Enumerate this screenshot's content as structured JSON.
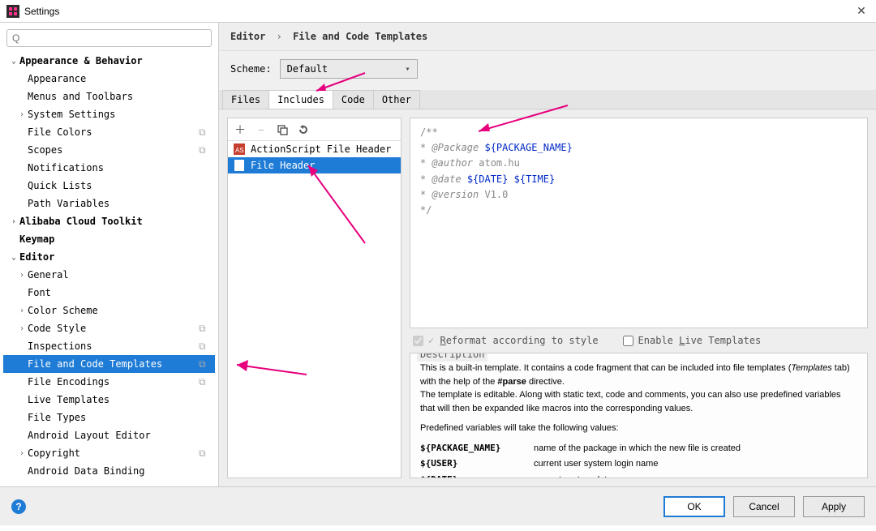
{
  "window": {
    "title": "Settings",
    "close_glyph": "✕"
  },
  "search": {
    "placeholder": "Q"
  },
  "tree": [
    {
      "label": "Appearance & Behavior",
      "chev": "⌄",
      "bold": true,
      "ind": 0
    },
    {
      "label": "Appearance",
      "ind": 1
    },
    {
      "label": "Menus and Toolbars",
      "ind": 1
    },
    {
      "label": "System Settings",
      "chev": "›",
      "ind": 1
    },
    {
      "label": "File Colors",
      "ind": 1,
      "copy": true
    },
    {
      "label": "Scopes",
      "ind": 1,
      "copy": true
    },
    {
      "label": "Notifications",
      "ind": 1
    },
    {
      "label": "Quick Lists",
      "ind": 1
    },
    {
      "label": "Path Variables",
      "ind": 1
    },
    {
      "label": "Alibaba Cloud Toolkit",
      "chev": "›",
      "bold": true,
      "ind": 0
    },
    {
      "label": "Keymap",
      "bold": true,
      "ind": 0
    },
    {
      "label": "Editor",
      "chev": "⌄",
      "bold": true,
      "ind": 0
    },
    {
      "label": "General",
      "chev": "›",
      "ind": 1
    },
    {
      "label": "Font",
      "ind": 1
    },
    {
      "label": "Color Scheme",
      "chev": "›",
      "ind": 1
    },
    {
      "label": "Code Style",
      "chev": "›",
      "ind": 1,
      "copy": true
    },
    {
      "label": "Inspections",
      "ind": 1,
      "copy": true
    },
    {
      "label": "File and Code Templates",
      "ind": 1,
      "copy": true,
      "sel": true
    },
    {
      "label": "File Encodings",
      "ind": 1,
      "copy": true
    },
    {
      "label": "Live Templates",
      "ind": 1
    },
    {
      "label": "File Types",
      "ind": 1
    },
    {
      "label": "Android Layout Editor",
      "ind": 1
    },
    {
      "label": "Copyright",
      "chev": "›",
      "ind": 1,
      "copy": true
    },
    {
      "label": "Android Data Binding",
      "ind": 1
    }
  ],
  "breadcrumb": {
    "a": "Editor",
    "b": "File and Code Templates"
  },
  "scheme": {
    "label": "Scheme:",
    "value": "Default"
  },
  "tabs": [
    "Files",
    "Includes",
    "Code",
    "Other"
  ],
  "active_tab": 1,
  "templates": [
    {
      "label": "ActionScript File Header",
      "icon": "as",
      "sel": false
    },
    {
      "label": "File Header",
      "icon": "file",
      "sel": true
    }
  ],
  "code": {
    "l0": "/**",
    "l1a": " * ",
    "l1b": "@Package",
    "l1c": " ",
    "l1d": "${PACKAGE_NAME}",
    "l2a": " * ",
    "l2b": "@author",
    "l2c": " atom.hu",
    "l3a": " * ",
    "l3b": "@date",
    "l3c": " ",
    "l3d": "${DATE}",
    "l3e": " ",
    "l3f": "${TIME}",
    "l4a": " * ",
    "l4b": "@version",
    "l4c": " V1.0",
    "l5": "*/"
  },
  "opts": {
    "reformat": "Reformat according to style",
    "live": "Enable Live Templates"
  },
  "desc": {
    "legend": "Description",
    "p1a": "This is a built-in template. It contains a code fragment that can be included into file templates (",
    "p1b": "Templates",
    "p1c": " tab) with the help of the ",
    "p1d": "#parse",
    "p1e": " directive.",
    "p2": "The template is editable. Along with static text, code and comments, you can also use predefined variables that will then be expanded like macros into the corresponding values.",
    "p3": "Predefined variables will take the following values:",
    "vars": [
      {
        "k": "${PACKAGE_NAME}",
        "v": "name of the package in which the new file is created"
      },
      {
        "k": "${USER}",
        "v": "current user system login name"
      },
      {
        "k": "${DATE}",
        "v": "current system date"
      }
    ]
  },
  "footer": {
    "ok": "OK",
    "cancel": "Cancel",
    "apply": "Apply"
  }
}
